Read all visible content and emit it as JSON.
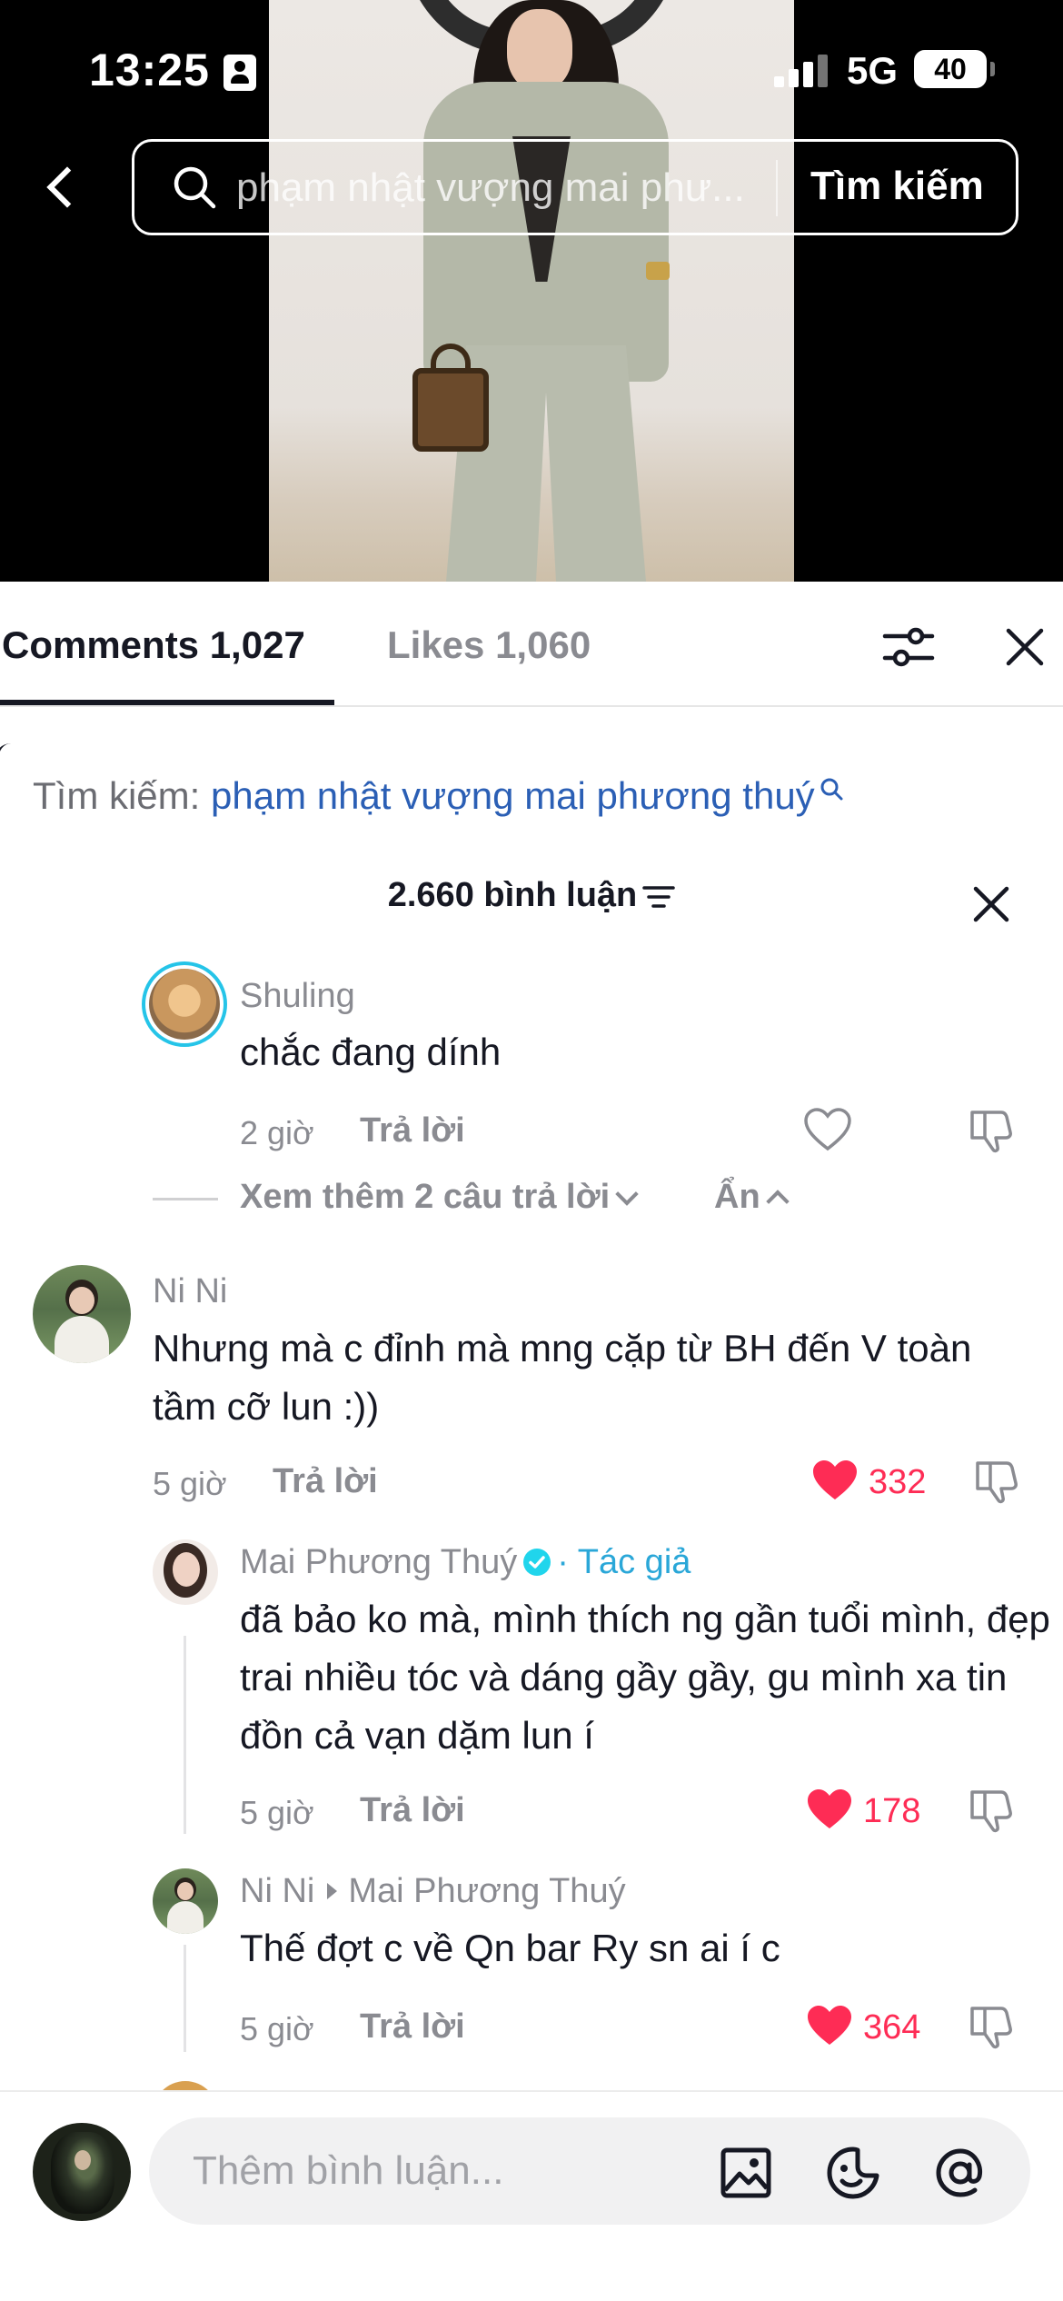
{
  "status_bar": {
    "time": "13:25",
    "network": "5G",
    "battery": "40"
  },
  "search": {
    "query": "phạm nhật vượng mai phư...",
    "button_label": "Tìm kiếm"
  },
  "tabs": {
    "comments_label": "Comments 1,027",
    "likes_label": "Likes 1,060"
  },
  "related_search": {
    "label": "Tìm kiếm:",
    "query": "phạm nhật vượng mai phương thuý"
  },
  "comments_header": {
    "count_label": "2.660 bình luận"
  },
  "comments": [
    {
      "name": "Shuling",
      "text": "chắc đang dính",
      "time": "2 giờ",
      "reply_label": "Trả lời",
      "liked": false,
      "more_replies_label": "Xem thêm 2 câu trả lời",
      "hide_label": "Ẩn"
    },
    {
      "name": "Ni Ni",
      "text": "Nhưng mà c đỉnh mà mng cặp từ BH đến V toàn tầm cỡ lun :))",
      "time": "5 giờ",
      "reply_label": "Trả lời",
      "likes": "332",
      "liked": true
    },
    {
      "name": "Mai Phương Thuý",
      "author_tag": "· Tác giả",
      "text": "đã bảo ko mà, mình thích ng gần tuổi mình, đẹp trai nhiều tóc và dáng gầy gầy, gu mình xa tin đồn cả vạn dặm lun í",
      "time": "5 giờ",
      "reply_label": "Trả lời",
      "likes": "178",
      "liked": true
    },
    {
      "name": "Ni Ni",
      "reply_to": "Mai Phương Thuý",
      "text": "Thế đợt c về Qn bar Ry sn ai í c",
      "time": "5 giờ",
      "reply_label": "Trả lời",
      "likes": "364",
      "liked": true
    }
  ],
  "input": {
    "placeholder": "Thêm bình luận..."
  },
  "colors": {
    "like_red": "#fe2c55",
    "link_blue": "#2b5fb5",
    "author_cyan": "#2aa7d8"
  },
  "icons": [
    "back-icon",
    "search-icon",
    "filter-icon",
    "close-icon",
    "sort-icon",
    "heart-icon",
    "dislike-icon",
    "verified-icon",
    "image-icon",
    "emoji-icon",
    "mention-icon"
  ]
}
